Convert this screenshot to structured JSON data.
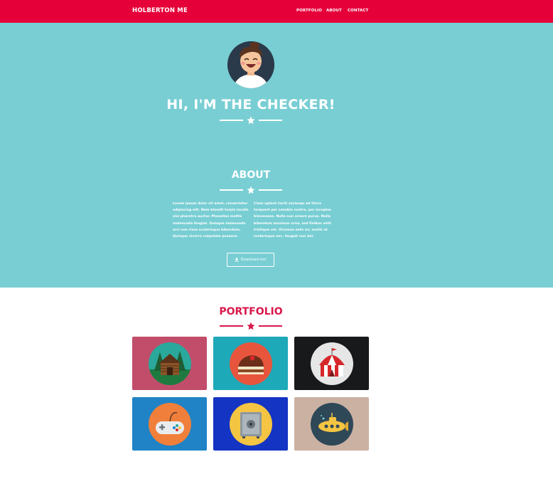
{
  "nav": {
    "brand": "HOLBERTON ME",
    "links": [
      "PORTFOLIO",
      "ABOUT",
      "CONTACT"
    ]
  },
  "hero": {
    "title": "HI, I'M THE CHECKER!"
  },
  "about": {
    "title": "ABOUT",
    "left_text": "Lorem ipsum dolor sit amet, consectetur adipiscing elit. Nam blandit turpis iaculis nisi pharetra auctor. Phasellus mattis malesuada feugiat. Quisque malesuada orci non risus scelerisque bibendum. Quisque viverra vulputate posuere.",
    "right_text": "Class aptent taciti sociosqu ad litora torquent per conubia nostra, per inceptos himenaeos. Nulla non ornare purus. Nulla bibendum maximus urna, sed finibus velit tristique vel. Vivamus ante mi, mollis at scelerisque nec, feugiat non dui.",
    "download_label": "Download me!"
  },
  "portfolio": {
    "title": "PORTFOLIO",
    "items": [
      {
        "icon": "cabin-icon",
        "bg": "#c14d6a",
        "circle": "#2aa89b"
      },
      {
        "icon": "cake-icon",
        "bg": "#1ea9b8",
        "circle": "#e8553d"
      },
      {
        "icon": "circus-tent-icon",
        "bg": "#17191a",
        "circle": "#e6e6e6"
      },
      {
        "icon": "game-controller-icon",
        "bg": "#1f83c6",
        "circle": "#f07f3b"
      },
      {
        "icon": "safe-icon",
        "bg": "#1434c3",
        "circle": "#f4c542"
      },
      {
        "icon": "submarine-icon",
        "bg": "#cbb1a2",
        "circle": "#2f4858"
      }
    ]
  },
  "colors": {
    "accent": "#e6003a",
    "hero_bg": "#78ced3",
    "portfolio_heading": "#d8174a"
  }
}
